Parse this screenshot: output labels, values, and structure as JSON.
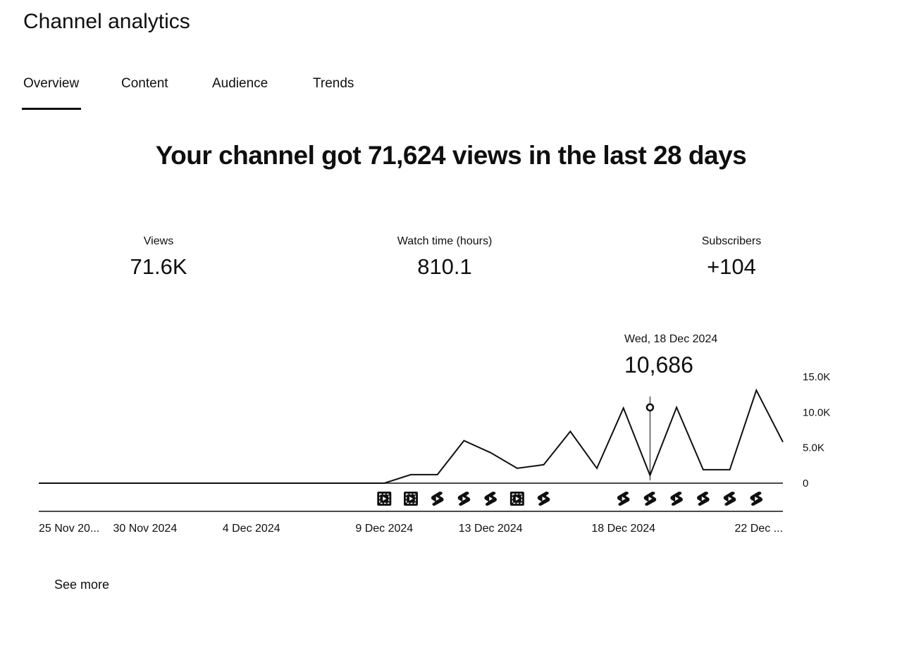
{
  "app": {
    "title": "Channel analytics"
  },
  "tabs": [
    {
      "label": "Overview",
      "selected": true
    },
    {
      "label": "Content"
    },
    {
      "label": "Audience"
    },
    {
      "label": "Trends"
    }
  ],
  "headline": "Your channel got 71,624 views in the last 28 days",
  "metrics": {
    "views": {
      "label": "Views",
      "value": "71.6K"
    },
    "watch_time": {
      "label": "Watch time (hours)",
      "value": "810.1"
    },
    "subscribers": {
      "label": "Subscribers",
      "value": "+104"
    }
  },
  "tooltip": {
    "date": "Wed, 18 Dec 2024",
    "value": "10,686"
  },
  "see_more": "See more",
  "colors": {
    "text": "#0f0f0f",
    "line": "#0f0f0f",
    "background": "#ffffff"
  },
  "chart_data": {
    "type": "line",
    "x": [
      "2024-11-25",
      "2024-11-26",
      "2024-11-27",
      "2024-11-28",
      "2024-11-29",
      "2024-11-30",
      "2024-12-01",
      "2024-12-02",
      "2024-12-03",
      "2024-12-04",
      "2024-12-05",
      "2024-12-06",
      "2024-12-07",
      "2024-12-08",
      "2024-12-09",
      "2024-12-10",
      "2024-12-11",
      "2024-12-12",
      "2024-12-13",
      "2024-12-14",
      "2024-12-15",
      "2024-12-16",
      "2024-12-17",
      "2024-12-18",
      "2024-12-19",
      "2024-12-20",
      "2024-12-21",
      "2024-12-22",
      "2024-12-23"
    ],
    "series": [
      {
        "values": [
          0,
          0,
          0,
          0,
          0,
          0,
          0,
          0,
          0,
          0,
          0,
          0,
          0,
          0,
          1200,
          1200,
          6000,
          4300,
          2100,
          2600,
          7300,
          2100,
          10600,
          1100,
          10686,
          1900,
          1900,
          13100,
          5800
        ]
      }
    ],
    "ylim": [
      0,
      15000
    ],
    "yticks": [
      "0",
      "5.0K",
      "10.0K",
      "15.0K"
    ],
    "xtick_labels": [
      "25 Nov 20...",
      "30 Nov 2024",
      "4 Dec 2024",
      "9 Dec 2024",
      "13 Dec 2024",
      "18 Dec 2024",
      "22 Dec ..."
    ],
    "xtick_dates": [
      "2024-11-25",
      "2024-11-29",
      "2024-12-03",
      "2024-12-08",
      "2024-12-12",
      "2024-12-17",
      "2024-12-21"
    ],
    "highlight": {
      "date": "2024-12-18",
      "value": 10686
    },
    "grid": false,
    "upload_markers": [
      {
        "date": "2024-12-08",
        "icon": "playlist-video-icon"
      },
      {
        "date": "2024-12-09",
        "icon": "playlist-video-icon"
      },
      {
        "date": "2024-12-10",
        "icon": "shorts-icon"
      },
      {
        "date": "2024-12-11",
        "icon": "shorts-icon"
      },
      {
        "date": "2024-12-12",
        "icon": "shorts-icon"
      },
      {
        "date": "2024-12-13",
        "icon": "playlist-video-icon"
      },
      {
        "date": "2024-12-14",
        "icon": "shorts-icon"
      },
      {
        "date": "2024-12-17",
        "icon": "shorts-icon"
      },
      {
        "date": "2024-12-18",
        "icon": "shorts-icon"
      },
      {
        "date": "2024-12-19",
        "icon": "shorts-icon"
      },
      {
        "date": "2024-12-20",
        "icon": "shorts-icon"
      },
      {
        "date": "2024-12-21",
        "icon": "shorts-icon"
      },
      {
        "date": "2024-12-22",
        "icon": "shorts-icon"
      }
    ]
  }
}
